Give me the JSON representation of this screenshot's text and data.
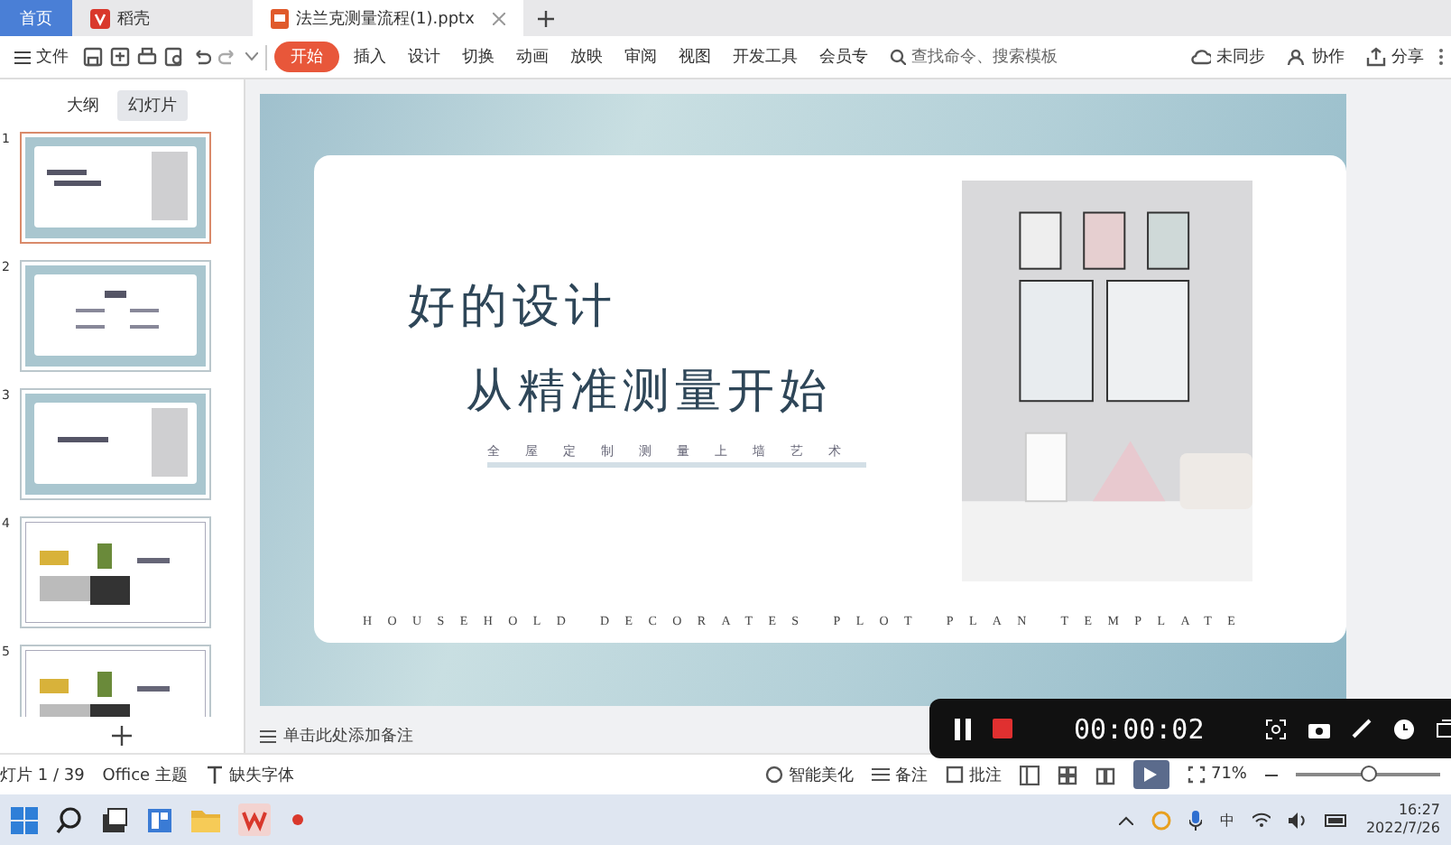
{
  "browser_tabs": [
    {
      "label": "首页",
      "selected": false,
      "kind": "home"
    },
    {
      "label": "稻壳",
      "selected": false,
      "kind": "app"
    },
    {
      "label": "法兰克测量流程(1).pptx",
      "selected": true,
      "kind": "doc"
    }
  ],
  "menu": {
    "file": "文件",
    "tabs": [
      {
        "label": "开始",
        "selected": true
      },
      {
        "label": "插入",
        "selected": false
      },
      {
        "label": "设计",
        "selected": false
      },
      {
        "label": "切换",
        "selected": false
      },
      {
        "label": "动画",
        "selected": false
      },
      {
        "label": "放映",
        "selected": false
      },
      {
        "label": "审阅",
        "selected": false
      },
      {
        "label": "视图",
        "selected": false
      },
      {
        "label": "开发工具",
        "selected": false
      },
      {
        "label": "会员专",
        "selected": false
      }
    ],
    "search": {
      "placeholder": "查找命令、搜索模板"
    },
    "actions": [
      "未同步",
      "协作",
      "分享"
    ]
  },
  "sidebar": {
    "tabs": [
      {
        "label": "大纲",
        "selected": false
      },
      {
        "label": "幻灯片",
        "selected": true
      }
    ],
    "thumbnails": [
      {
        "number": "1",
        "selected": true,
        "kind": "title"
      },
      {
        "number": "2",
        "selected": false,
        "kind": "contents"
      },
      {
        "number": "3",
        "selected": false,
        "kind": "section"
      },
      {
        "number": "4",
        "selected": false,
        "kind": "gallery"
      },
      {
        "number": "5",
        "selected": false,
        "kind": "gallery"
      }
    ]
  },
  "slide": {
    "title": "好的设计",
    "subtitle": "从精准测量开始",
    "tagline": "全屋定制测量上墙艺术",
    "footer": "HOUSEHOLD DECORATES PLOT PLAN TEMPLATE"
  },
  "notes": {
    "placeholder": "单击此处添加备注"
  },
  "status_bar": {
    "slide_count": "灯片 1 / 39",
    "theme": "Office 主题",
    "missing_fonts": "缺失字体",
    "beautify": "智能美化",
    "notes": "备注",
    "comments": "批注",
    "zoom": "71%",
    "zoom_slider": {
      "level": 0.5
    }
  },
  "recorder": {
    "time": "00:00:02"
  },
  "taskbar": {
    "ime": "中",
    "time": "16:27",
    "date": "2022/7/26"
  }
}
